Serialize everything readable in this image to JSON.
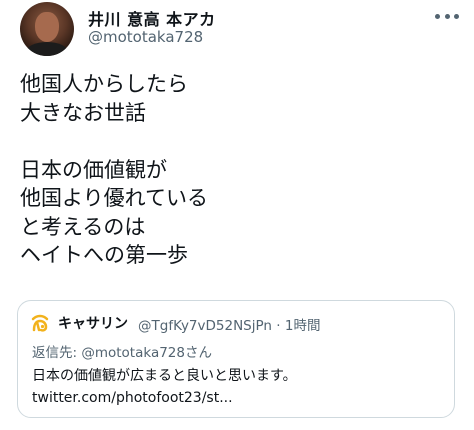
{
  "tweet": {
    "author": {
      "display_name": "井川 意高 本アカ",
      "handle": "@mototaka728",
      "avatar_icon": "profile-photo"
    },
    "more_icon": "more-dots-icon",
    "text": "他国人からしたら\n大きなお世話\n\n日本の価値観が\n他国より優れている\nと考えるのは\nヘイトへの第一歩"
  },
  "quote": {
    "author": {
      "display_name": "キャサリン",
      "handle": "@TgfKy7vD52NSjPn",
      "avatar_icon": "yellow-glyph-avatar"
    },
    "separator": "·",
    "time": "1時間",
    "reply_to": "返信先: @mototaka728さん",
    "text": "日本の価値観が広まると良いと思います。\ntwitter.com/photofoot23/st..."
  },
  "colors": {
    "text": "#0f1419",
    "secondary": "#536471",
    "border": "#cfd9de",
    "quote_avatar": "#f2b21c"
  }
}
